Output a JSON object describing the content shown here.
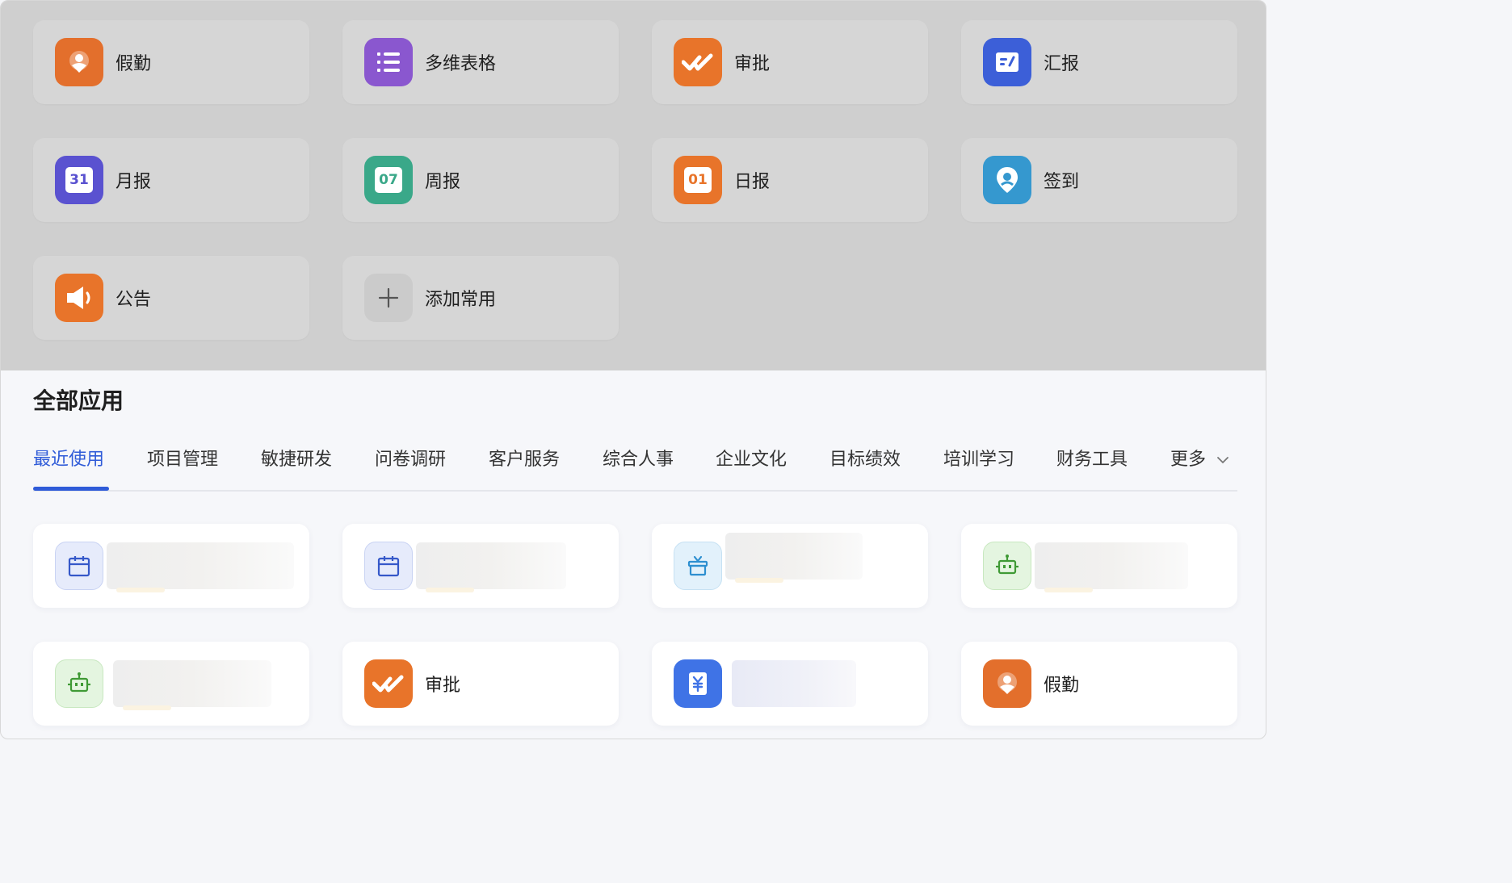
{
  "common_apps": [
    {
      "label": "假勤",
      "icon": "person-location-icon",
      "color": "#e36f2c"
    },
    {
      "label": "多维表格",
      "icon": "list-icon",
      "color": "#8a57cf"
    },
    {
      "label": "审批",
      "icon": "double-check-icon",
      "color": "#e8742a"
    },
    {
      "label": "汇报",
      "icon": "report-note-icon",
      "color": "#3c5fd8"
    },
    {
      "label": "月报",
      "icon": "calendar-31-icon",
      "color": "#5a52d0",
      "badge": "31"
    },
    {
      "label": "周报",
      "icon": "calendar-07-icon",
      "color": "#3aa889",
      "badge": "07"
    },
    {
      "label": "日报",
      "icon": "calendar-01-icon",
      "color": "#e8742a",
      "badge": "01"
    },
    {
      "label": "签到",
      "icon": "location-pin-icon",
      "color": "#3598cf"
    },
    {
      "label": "公告",
      "icon": "megaphone-icon",
      "color": "#e8742a"
    },
    {
      "label": "添加常用",
      "icon": "plus-icon",
      "color": "#cfcfcf"
    }
  ],
  "section_title": "全部应用",
  "tabs": [
    "最近使用",
    "项目管理",
    "敏捷研发",
    "问卷调研",
    "客户服务",
    "综合人事",
    "企业文化",
    "目标绩效",
    "培训学习",
    "财务工具",
    "更多"
  ],
  "active_tab": "最近使用",
  "recent_apps": [
    {
      "label": "",
      "icon": "calendar-icon",
      "color": "#e6ebfb",
      "blurred": true
    },
    {
      "label": "",
      "icon": "calendar-icon",
      "color": "#e6ebfb",
      "blurred": true
    },
    {
      "label": "",
      "icon": "gift-box-icon",
      "color": "#e2f1fb",
      "blurred": true
    },
    {
      "label": "",
      "icon": "robot-icon",
      "color": "#e4f5e0",
      "blurred": true
    },
    {
      "label": "",
      "icon": "robot-icon",
      "color": "#e4f5e0",
      "blurred": true
    },
    {
      "label": "审批",
      "icon": "double-check-icon",
      "color": "#e8742a",
      "blurred": false
    },
    {
      "label": "",
      "icon": "yuan-document-icon",
      "color": "#3f73e6",
      "blurred": true
    },
    {
      "label": "假勤",
      "icon": "person-location-icon",
      "color": "#e36f2c",
      "blurred": false
    }
  ],
  "colors": {
    "accent": "#2f5bd8",
    "overlay": "#cfcfcf"
  }
}
